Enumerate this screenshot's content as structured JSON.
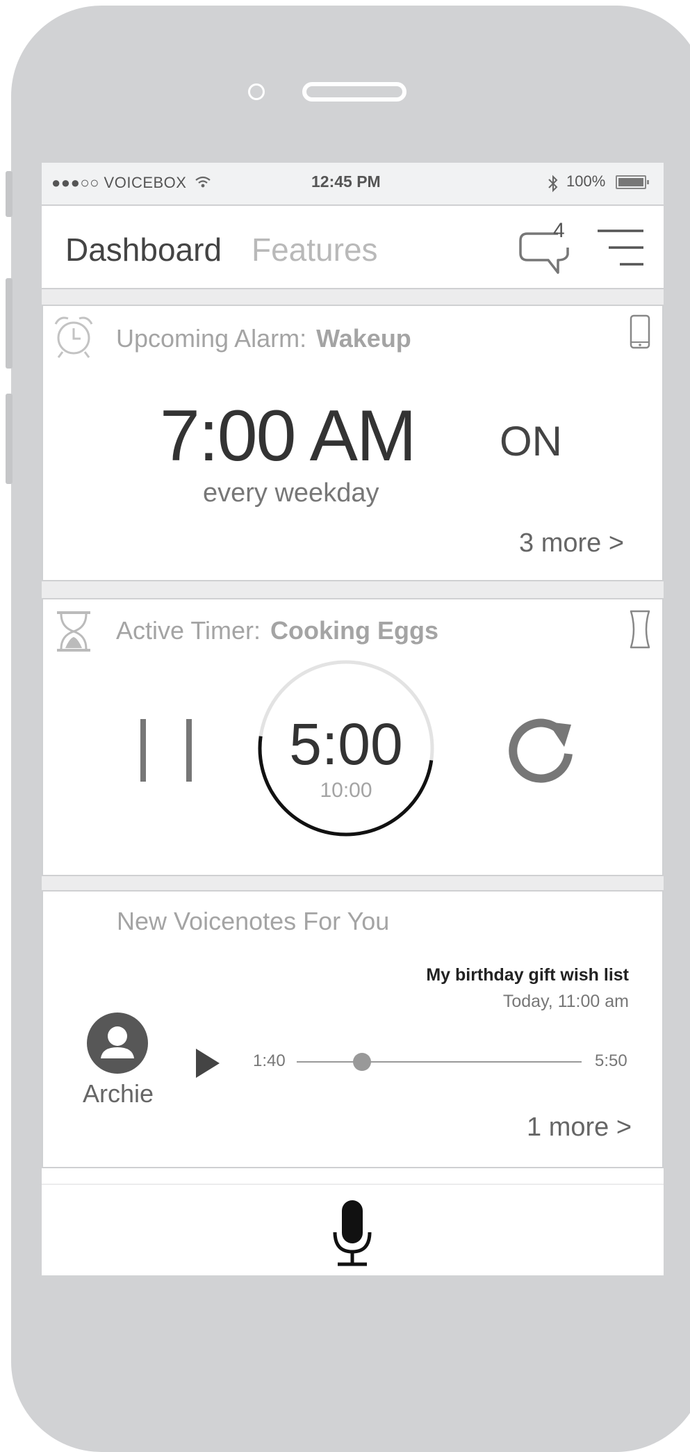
{
  "status_bar": {
    "carrier": "●●●○○ VOICEBOX",
    "time": "12:45 PM",
    "battery": "100%"
  },
  "nav": {
    "tabs": [
      {
        "label": "Dashboard",
        "active": true
      },
      {
        "label": "Features",
        "active": false
      }
    ],
    "message_count": "4"
  },
  "alarm": {
    "label": "Upcoming Alarm:",
    "name": "Wakeup",
    "time": "7:00 AM",
    "status": "ON",
    "repeat": "every weekday",
    "more": "3 more >"
  },
  "timer": {
    "label": "Active Timer:",
    "name": "Cooking Eggs",
    "remaining": "5:00",
    "total": "10:00",
    "progress_fraction": 0.5
  },
  "voicenotes": {
    "heading": "New Voicenotes For You",
    "note": {
      "title": "My birthday gift wish list",
      "date": "Today, 11:00 am",
      "sender": "Archie",
      "elapsed": "1:40",
      "duration": "5:50",
      "progress_fraction": 0.23
    },
    "more": "1 more >"
  },
  "icons": {
    "alarm": "alarm-clock-icon",
    "device": "phone-icon",
    "timer": "hourglass-icon",
    "timer_device": "cup-icon",
    "chat": "speech-bubble-icon",
    "menu": "hamburger-icon",
    "pause": "pause-icon",
    "reset": "refresh-icon",
    "play": "play-icon",
    "avatar": "person-icon",
    "mic": "microphone-icon"
  }
}
